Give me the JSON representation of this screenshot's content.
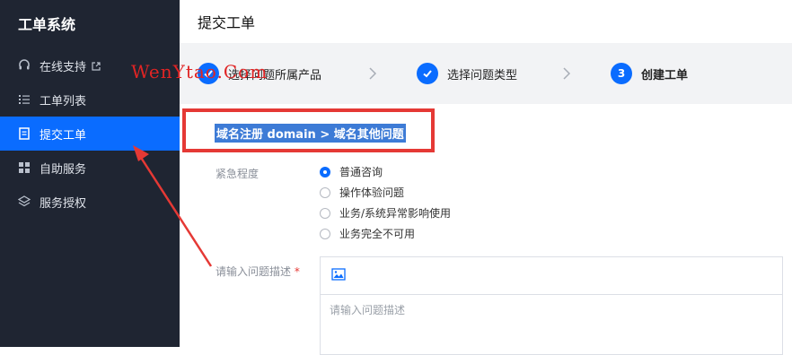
{
  "sidebar": {
    "title": "工单系统",
    "items": [
      {
        "label": "在线支持",
        "icon": "headset-icon"
      },
      {
        "label": "工单列表",
        "icon": "list-icon"
      },
      {
        "label": "提交工单",
        "icon": "form-icon",
        "active": true
      },
      {
        "label": "自助服务",
        "icon": "grid-icon"
      },
      {
        "label": "服务授权",
        "icon": "layers-icon"
      }
    ]
  },
  "main": {
    "title": "提交工单",
    "steps": [
      {
        "label": "选择问题所属产品",
        "status": "done"
      },
      {
        "label": "选择问题类型",
        "status": "done"
      },
      {
        "number": "3",
        "label": "创建工单",
        "status": "current"
      }
    ],
    "breadcrumb": "域名注册 domain > 域名其他问题",
    "urgency": {
      "label": "紧急程度",
      "options": [
        "普通咨询",
        "操作体验问题",
        "业务/系统异常影响使用",
        "业务完全不可用"
      ],
      "selected": "普通咨询"
    },
    "description": {
      "label": "请输入问题描述",
      "required_mark": "*",
      "placeholder": "请输入问题描述"
    }
  },
  "watermark": "WenYtao.Com",
  "colors": {
    "sidebar_bg": "#1f2532",
    "accent": "#0a6cff",
    "annotation_red": "#e53935",
    "stepper_bg": "#f2f3f5"
  }
}
